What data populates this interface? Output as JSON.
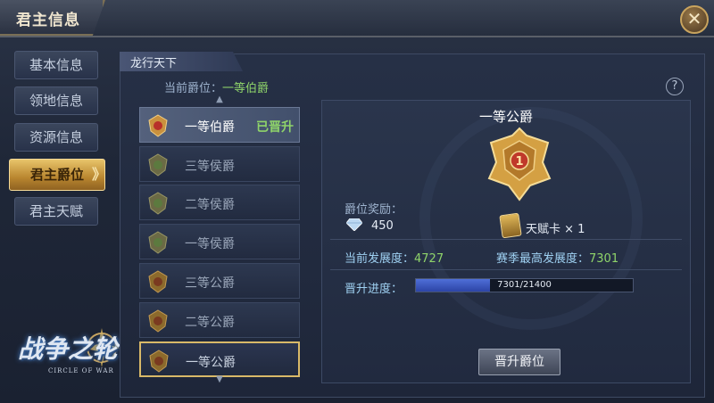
{
  "window": {
    "title": "君主信息",
    "close": "✕"
  },
  "nav": {
    "items": [
      {
        "label": "基本信息"
      },
      {
        "label": "领地信息"
      },
      {
        "label": "资源信息"
      },
      {
        "label": "君主爵位"
      },
      {
        "label": "君主天赋"
      }
    ],
    "active_index": 3,
    "active_arrow": "》"
  },
  "logo": {
    "text": "战争之轮",
    "subtitle": "CIRCLE OF WAR"
  },
  "section": {
    "title": "龙行天下"
  },
  "current_rank": {
    "label": "当前爵位：",
    "value": "一等伯爵"
  },
  "help": "?",
  "rank_list": [
    {
      "name": "一等伯爵",
      "status": "已晋升",
      "tier": "gold-ruby"
    },
    {
      "name": "三等侯爵",
      "status": "",
      "tier": "olive"
    },
    {
      "name": "二等侯爵",
      "status": "",
      "tier": "olive"
    },
    {
      "name": "一等侯爵",
      "status": "",
      "tier": "olive"
    },
    {
      "name": "三等公爵",
      "status": "",
      "tier": "gold"
    },
    {
      "name": "二等公爵",
      "status": "",
      "tier": "gold"
    },
    {
      "name": "一等公爵",
      "status": "",
      "tier": "gold"
    }
  ],
  "detail": {
    "title": "一等公爵",
    "reward_label": "爵位奖励：",
    "diamond_value": "450",
    "card_text": "天赋卡 × 1",
    "current_dev_label": "当前发展度：",
    "current_dev_value": "4727",
    "season_max_label": "赛季最高发展度：",
    "season_max_value": "7301",
    "progress_label": "晋升进度：",
    "progress_text": "7301/21400",
    "progress_fraction": 0.341,
    "promote_button": "晋升爵位"
  },
  "colors": {
    "accent_gold": "#d9b968",
    "green": "#8fd46a",
    "progress_blue": "#3f5cc8"
  }
}
